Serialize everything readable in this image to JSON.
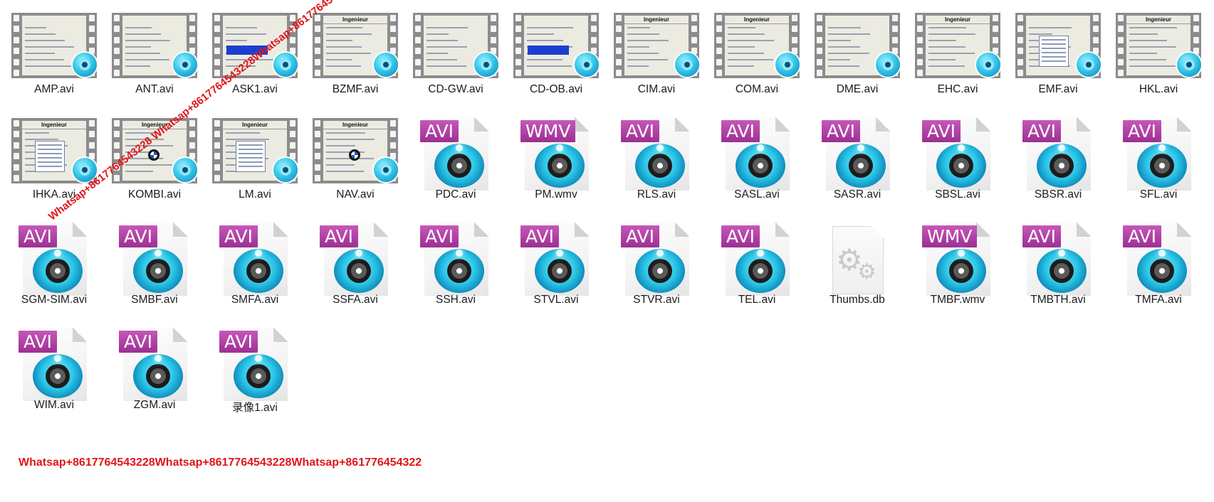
{
  "files": [
    {
      "name": "AMP.avi",
      "kind": "video-preview"
    },
    {
      "name": "ANT.avi",
      "kind": "video-preview"
    },
    {
      "name": "ASK1.avi",
      "kind": "video-preview"
    },
    {
      "name": "BZMF.avi",
      "kind": "video-preview",
      "frame_title": "Ingenieur"
    },
    {
      "name": "CD-GW.avi",
      "kind": "video-preview"
    },
    {
      "name": "CD-OB.avi",
      "kind": "video-preview"
    },
    {
      "name": "CIM.avi",
      "kind": "video-preview",
      "frame_title": "Ingenieur"
    },
    {
      "name": "COM.avi",
      "kind": "video-preview",
      "frame_title": "Ingenieur"
    },
    {
      "name": "DME.avi",
      "kind": "video-preview"
    },
    {
      "name": "EHC.avi",
      "kind": "video-preview",
      "frame_title": "Ingenieur"
    },
    {
      "name": "EMF.avi",
      "kind": "video-preview"
    },
    {
      "name": "HKL.avi",
      "kind": "video-preview",
      "frame_title": "Ingenieur"
    },
    {
      "name": "IHKA.avi",
      "kind": "video-preview",
      "frame_title": "Ingenieur"
    },
    {
      "name": "KOMBI.avi",
      "kind": "video-preview",
      "frame_title": "Ingenieur"
    },
    {
      "name": "LM.avi",
      "kind": "video-preview",
      "frame_title": "Ingenieur"
    },
    {
      "name": "NAV.avi",
      "kind": "video-preview",
      "frame_title": "Ingenieur"
    },
    {
      "name": "PDC.avi",
      "kind": "file",
      "tag": "AVI"
    },
    {
      "name": "PM.wmv",
      "kind": "file",
      "tag": "WMV"
    },
    {
      "name": "RLS.avi",
      "kind": "file",
      "tag": "AVI"
    },
    {
      "name": "SASL.avi",
      "kind": "file",
      "tag": "AVI"
    },
    {
      "name": "SASR.avi",
      "kind": "file",
      "tag": "AVI"
    },
    {
      "name": "SBSL.avi",
      "kind": "file",
      "tag": "AVI"
    },
    {
      "name": "SBSR.avi",
      "kind": "file",
      "tag": "AVI"
    },
    {
      "name": "SFL.avi",
      "kind": "file",
      "tag": "AVI"
    },
    {
      "name": "SGM-SIM.avi",
      "kind": "file",
      "tag": "AVI"
    },
    {
      "name": "SMBF.avi",
      "kind": "file",
      "tag": "AVI"
    },
    {
      "name": "SMFA.avi",
      "kind": "file",
      "tag": "AVI"
    },
    {
      "name": "SSFA.avi",
      "kind": "file",
      "tag": "AVI"
    },
    {
      "name": "SSH.avi",
      "kind": "file",
      "tag": "AVI"
    },
    {
      "name": "STVL.avi",
      "kind": "file",
      "tag": "AVI"
    },
    {
      "name": "STVR.avi",
      "kind": "file",
      "tag": "AVI"
    },
    {
      "name": "TEL.avi",
      "kind": "file",
      "tag": "AVI"
    },
    {
      "name": "Thumbs.db",
      "kind": "system"
    },
    {
      "name": "TMBF.wmv",
      "kind": "file",
      "tag": "WMV"
    },
    {
      "name": "TMBTH.avi",
      "kind": "file",
      "tag": "AVI"
    },
    {
      "name": "TMFA.avi",
      "kind": "file",
      "tag": "AVI"
    },
    {
      "name": "WIM.avi",
      "kind": "file",
      "tag": "AVI"
    },
    {
      "name": "ZGM.avi",
      "kind": "file",
      "tag": "AVI"
    },
    {
      "name": "录像1.avi",
      "kind": "file",
      "tag": "AVI"
    }
  ],
  "watermark": {
    "diagonal_text": "Whatsap+8617764543228 Whatsap+8617764543228Whatsap+8617764543228",
    "footer_text": "Whatsap+8617764543228Whatsap+8617764543228Whatsap+861776454322",
    "color": "#e0151a"
  },
  "colors": {
    "avi_tag": "#b044a6",
    "reel_cyan": "#2bc5e7",
    "label_text": "#1b1b1b"
  }
}
